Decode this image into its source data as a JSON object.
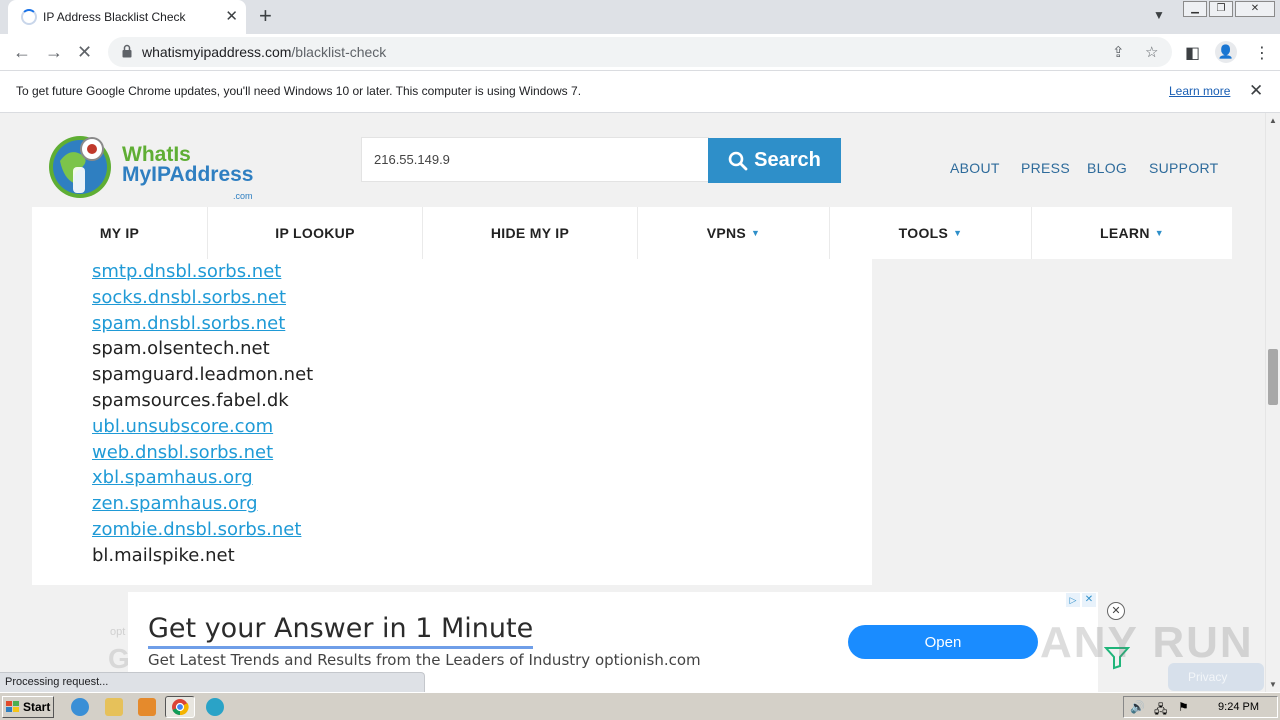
{
  "browser": {
    "tab_title": "IP Address Blacklist Check",
    "tab_close": "✕",
    "new_tab": "+",
    "url_host": "whatismyipaddress.com",
    "url_path": "/blacklist-check"
  },
  "infobar": {
    "message": "To get future Google Chrome updates, you'll need Windows 10 or later. This computer is using Windows 7.",
    "learn_more": "Learn more",
    "close": "✕"
  },
  "site": {
    "logo_line1": "WhatIs",
    "logo_line2": "MyIPAddress",
    "logo_com": ".com",
    "search_value": "216.55.149.9",
    "search_button": "Search",
    "top_links": [
      "ABOUT",
      "PRESS",
      "BLOG",
      "SUPPORT"
    ],
    "nav": [
      {
        "label": "MY IP",
        "caret": ""
      },
      {
        "label": "IP LOOKUP",
        "caret": ""
      },
      {
        "label": "HIDE MY IP",
        "caret": ""
      },
      {
        "label": "VPNS",
        "caret": "▼"
      },
      {
        "label": "TOOLS",
        "caret": "▼"
      },
      {
        "label": "LEARN",
        "caret": "▼"
      }
    ],
    "blacklists": [
      {
        "name": "smtp.dnsbl.sorbs.net",
        "link": true
      },
      {
        "name": "socks.dnsbl.sorbs.net",
        "link": true
      },
      {
        "name": "spam.dnsbl.sorbs.net",
        "link": true
      },
      {
        "name": "spam.olsentech.net",
        "link": false
      },
      {
        "name": "spamguard.leadmon.net",
        "link": false
      },
      {
        "name": "spamsources.fabel.dk",
        "link": false
      },
      {
        "name": "ubl.unsubscore.com",
        "link": true
      },
      {
        "name": "web.dnsbl.sorbs.net",
        "link": true
      },
      {
        "name": "xbl.spamhaus.org",
        "link": true
      },
      {
        "name": "zen.spamhaus.org",
        "link": true
      },
      {
        "name": "zombie.dnsbl.sorbs.net",
        "link": true
      },
      {
        "name": "bl.mailspike.net",
        "link": false
      }
    ]
  },
  "ad": {
    "headline": "Get your Answer in 1 Minute",
    "subtext": "Get Latest Trends and Results from the Leaders of Industry optionish.com",
    "button": "Open"
  },
  "watermark": "ANY RUN",
  "privacy_label": "Privacy",
  "status": "Processing request...",
  "taskbar": {
    "start": "Start",
    "clock": "9:24 PM"
  },
  "colors": {
    "link": "#1f9ad6",
    "search_button": "#2e8fc9",
    "ad_button": "#1a8cff"
  }
}
